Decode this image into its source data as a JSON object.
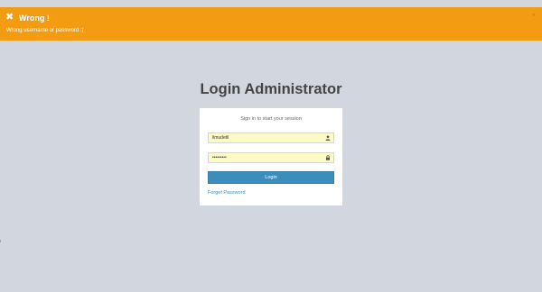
{
  "alert": {
    "icon": "close-x-icon",
    "title": "Wrong !",
    "message": "Wrong username or password :(",
    "close_symbol": "×",
    "color": "#f39c12"
  },
  "page": {
    "heading": "Login Administrator",
    "background": "#d2d6de"
  },
  "login": {
    "subtitle": "Sign in to start your session",
    "username": {
      "value": "ilmudetil",
      "icon": "user-icon"
    },
    "password": {
      "value": "ilmudetil",
      "icon": "lock-icon"
    },
    "login_button": "Login",
    "forget_link": "Forget Password",
    "accent_color": "#3c8dbc"
  }
}
